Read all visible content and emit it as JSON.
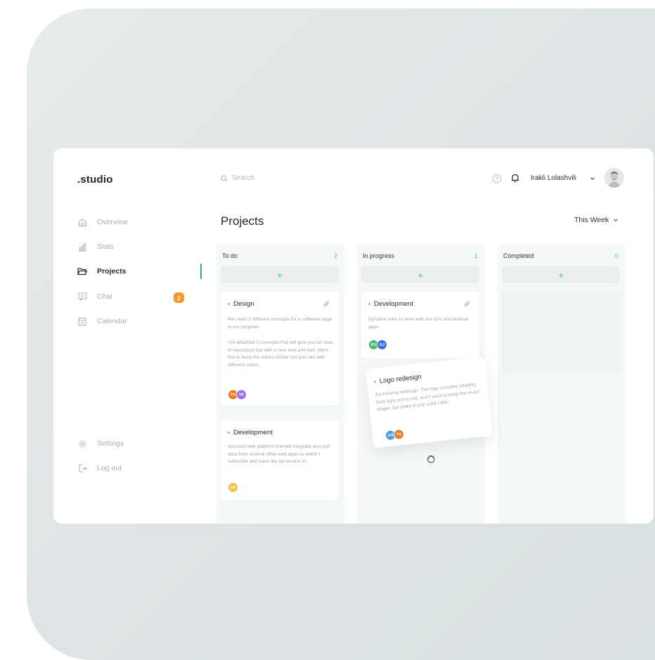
{
  "app": {
    "logo": ".studio"
  },
  "sidebar": {
    "items": [
      {
        "label": "Overview",
        "icon": "home-icon"
      },
      {
        "label": "Stats",
        "icon": "stats-icon"
      },
      {
        "label": "Projects",
        "icon": "folder-icon"
      },
      {
        "label": "Chat",
        "icon": "chat-icon",
        "badge": "2"
      },
      {
        "label": "Calendar",
        "icon": "calendar-icon"
      }
    ],
    "bottom": [
      {
        "label": "Settings",
        "icon": "gear-icon"
      },
      {
        "label": "Log out",
        "icon": "logout-icon"
      }
    ]
  },
  "header": {
    "search_placeholder": "Search",
    "user_name": "Irakli Lolashvili"
  },
  "page": {
    "title": "Projects",
    "range": "This Week"
  },
  "board": {
    "columns": [
      {
        "name": "To do",
        "count": "2",
        "add": "+"
      },
      {
        "name": "In progress",
        "count": "1",
        "add": "+"
      },
      {
        "name": "Completed",
        "count": "0",
        "add": "+"
      }
    ],
    "cards": [
      {
        "title": "Design",
        "text1": "We need 2 different concepts for a software page in our program",
        "text2": "I've attached 2 concepts that will give you an idea to reproduce but with a new look and feel. We'd like to keep the colors similar but you can add different colors.",
        "avatars": [
          "TK",
          "VE"
        ]
      },
      {
        "title": "Development",
        "text": "Secured web platform that will integrate and pull data from several other web apps to which I subscribe and have the api access to.",
        "avatars": [
          "LB"
        ]
      },
      {
        "title": "Development",
        "text": "Dynamic links to work with our iOS and Android apps",
        "avatars": [
          "DV",
          "GJ"
        ]
      },
      {
        "title": "Logo redesign",
        "text": "An existing redesign. The logo includes shading from light red to red, and I want to keep the exact shape, but make it one solid color.",
        "avatars": [
          "AN",
          "TK"
        ]
      }
    ]
  },
  "colors": {
    "accent": "#3da38f",
    "badge": "#f39a2b",
    "count": "#6bb7c3",
    "avatar_orange": "#f07a25",
    "avatar_purple": "#9b6cf0",
    "avatar_green": "#3fbf6a",
    "avatar_blue": "#3e6fe0",
    "avatar_yellow": "#f2c23a",
    "avatar_lightblue": "#4a9ee8"
  }
}
